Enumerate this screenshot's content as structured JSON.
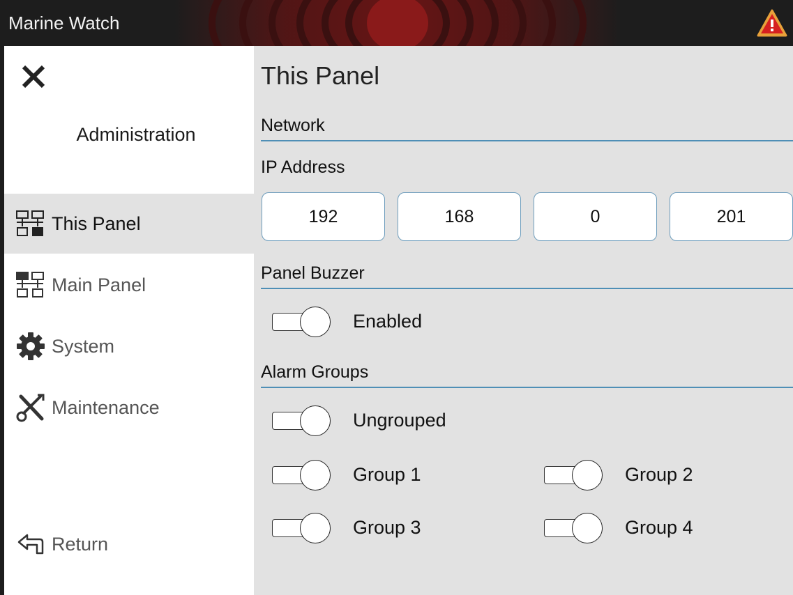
{
  "app": {
    "title": "Marine Watch"
  },
  "sidebar": {
    "heading": "Administration",
    "items": [
      {
        "label": "This Panel",
        "icon": "network-panel-icon",
        "active": true
      },
      {
        "label": "Main Panel",
        "icon": "network-main-icon",
        "active": false
      },
      {
        "label": "System",
        "icon": "gear-icon",
        "active": false
      },
      {
        "label": "Maintenance",
        "icon": "tools-icon",
        "active": false
      }
    ],
    "return_label": "Return"
  },
  "main": {
    "title": "This Panel",
    "network": {
      "section": "Network",
      "ip_label": "IP Address",
      "ip": [
        "192",
        "168",
        "0",
        "201"
      ]
    },
    "buzzer": {
      "section": "Panel Buzzer",
      "enabled_label": "Enabled"
    },
    "alarm_groups": {
      "section": "Alarm Groups",
      "items": [
        "Ungrouped",
        "Group 1",
        "Group 2",
        "Group 3",
        "Group 4"
      ]
    }
  },
  "colors": {
    "accent_line": "#4f8fb6",
    "titlebar": "#1d1d1d",
    "panel_bg": "#e2e2e2",
    "alert": "#d62020"
  }
}
